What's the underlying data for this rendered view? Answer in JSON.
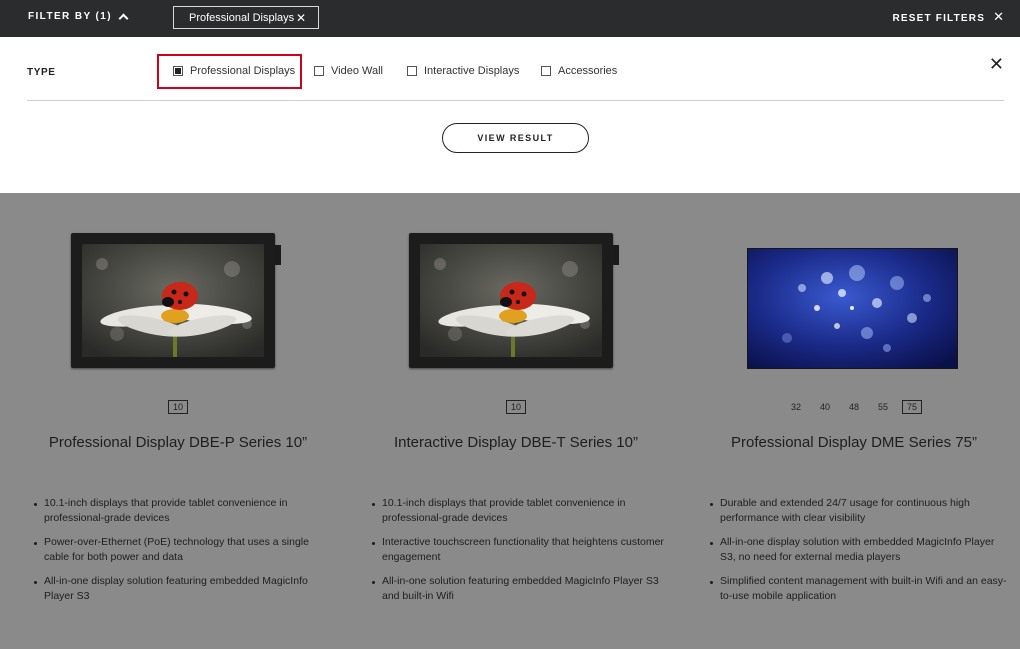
{
  "topbar": {
    "filter_by_label": "FILTER BY (1)",
    "active_chip": "Professional Displays",
    "reset_label": "RESET FILTERS"
  },
  "filter_panel": {
    "type_label": "TYPE",
    "options": [
      {
        "label": "Professional Displays",
        "checked": true
      },
      {
        "label": "Video Wall",
        "checked": false
      },
      {
        "label": "Interactive Displays",
        "checked": false
      },
      {
        "label": "Accessories",
        "checked": false
      }
    ],
    "view_result_label": "VIEW RESULT"
  },
  "products": [
    {
      "title": "Professional Display DBE-P Series 10”",
      "sizes": [
        "10"
      ],
      "active_size": "10",
      "bullets": [
        "10.1-inch displays that provide tablet convenience in professional-grade devices",
        "Power-over-Ethernet (PoE) technology that uses a single cable for both power and data",
        "All-in-one display solution featuring embedded MagicInfo Player S3"
      ]
    },
    {
      "title": "Interactive Display DBE-T Series 10”",
      "sizes": [
        "10"
      ],
      "active_size": "10",
      "bullets": [
        "10.1-inch displays that provide tablet convenience in professional-grade devices",
        "Interactive touchscreen functionality that heightens customer engagement",
        "All-in-one solution featuring embedded MagicInfo Player S3 and built-in Wifi"
      ]
    },
    {
      "title": "Professional Display DME Series 75”",
      "sizes": [
        "32",
        "40",
        "48",
        "55",
        "75"
      ],
      "active_size": "75",
      "bullets": [
        "Durable and extended 24/7 usage for continuous high performance with clear visibility",
        "All-in-one display solution with embedded MagicInfo Player S3, no need for external media players",
        "Simplified content management with built-in Wifi and an easy-to-use mobile application"
      ]
    }
  ],
  "colors": {
    "topbar_bg": "#2b2c2e",
    "overlay_bg": "#8a8a8a",
    "highlight_border": "#d0021b"
  }
}
